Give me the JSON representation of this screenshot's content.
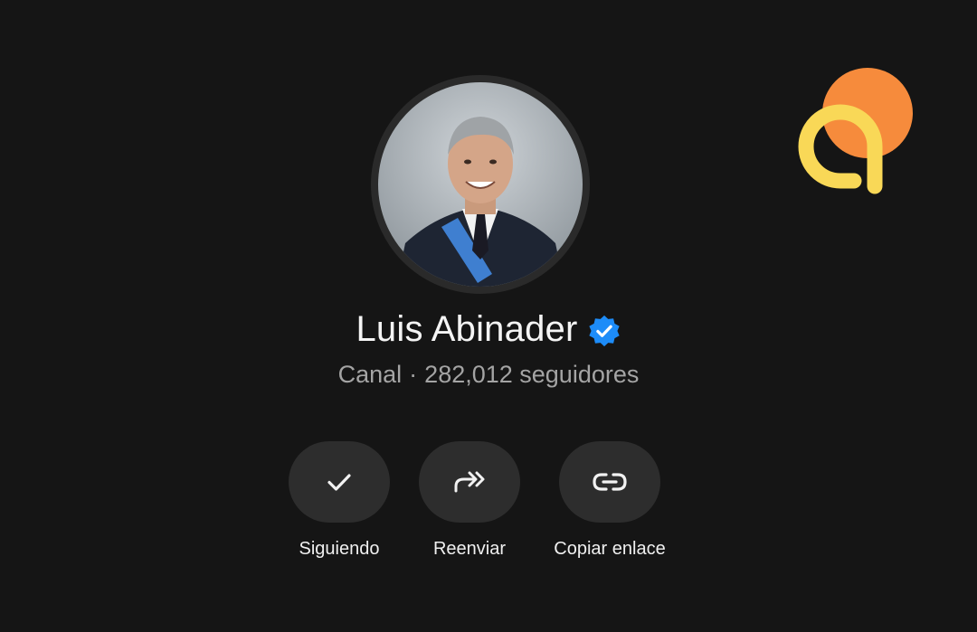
{
  "channel": {
    "name": "Luis Abinader",
    "type_label": "Canal",
    "separator": "·",
    "followers_text": "282,012 seguidores",
    "verified": true,
    "avatar_icon": "profile-photo"
  },
  "actions": [
    {
      "label": "Siguiendo",
      "icon": "check-icon"
    },
    {
      "label": "Reenviar",
      "icon": "forward-icon"
    },
    {
      "label": "Copiar enlace",
      "icon": "link-icon"
    }
  ],
  "brand": {
    "logo_icon": "brand-logo-icon",
    "colors": {
      "orange": "#F68B3C",
      "yellow": "#F9D857"
    }
  },
  "colors": {
    "background": "#151515",
    "button_bg": "#2D2D2D",
    "verified_blue": "#1D8CF8",
    "muted_text": "#A4A4A4"
  }
}
